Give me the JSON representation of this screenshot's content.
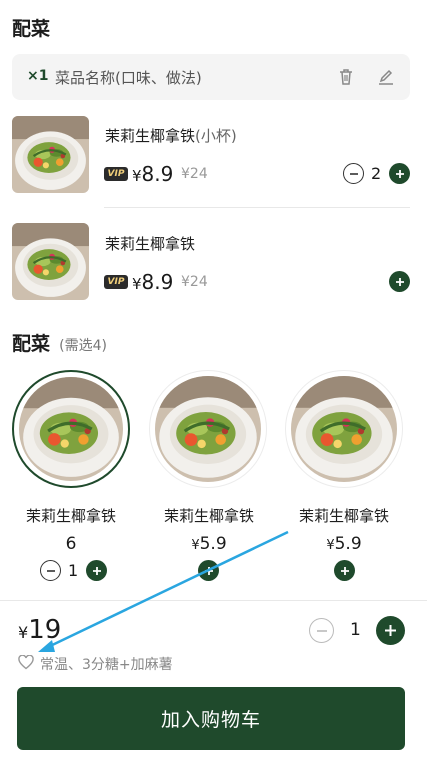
{
  "section_title": "配菜",
  "selection": {
    "qty": "×1",
    "name": "菜品名称(口味、做法)"
  },
  "items": [
    {
      "name": "茉莉生椰拿铁",
      "sub": "(小杯)",
      "vip_label": "VIP",
      "price_symbol": "¥",
      "price": "8.9",
      "original_price": "¥24",
      "qty": "2"
    },
    {
      "name": "茉莉生椰拿铁",
      "sub": "",
      "vip_label": "VIP",
      "price_symbol": "¥",
      "price": "8.9",
      "original_price": "¥24",
      "qty": ""
    }
  ],
  "sides_header": {
    "title": "配菜",
    "note": "(需选4)"
  },
  "sides": [
    {
      "name": "茉莉生椰拿铁",
      "price_symbol": "",
      "price": "6",
      "qty": "1",
      "selected": true
    },
    {
      "name": "茉莉生椰拿铁",
      "price_symbol": "¥",
      "price": "5.9",
      "qty": "",
      "selected": false
    },
    {
      "name": "茉莉生椰拿铁",
      "price_symbol": "¥",
      "price": "5.9",
      "qty": "",
      "selected": false
    }
  ],
  "footer": {
    "total_symbol": "¥",
    "total": "19",
    "options": "常温、3分糖+加麻薯",
    "qty": "1",
    "add_to_cart": "加入购物车"
  },
  "colors": {
    "brand_green": "#1f4a2c",
    "annotation_arrow": "#2aa6e0"
  },
  "icons": [
    "trash-icon",
    "edit-icon",
    "plus-icon",
    "minus-icon",
    "heart-icon"
  ]
}
